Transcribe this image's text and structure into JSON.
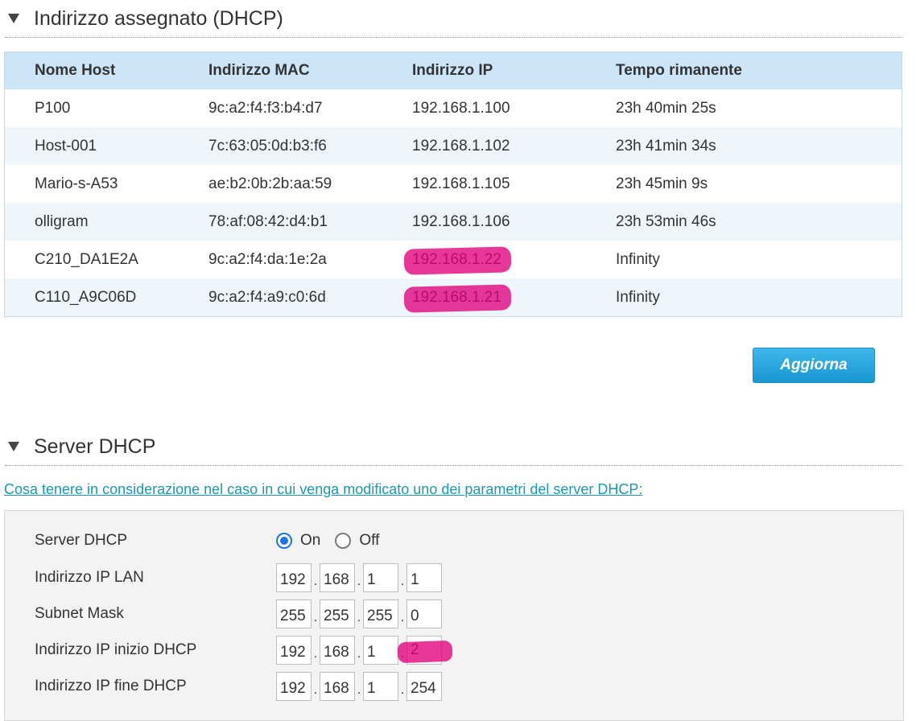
{
  "section_assigned": {
    "title": "Indirizzo assegnato (DHCP)"
  },
  "lease_table": {
    "headers": [
      "Nome Host",
      "Indirizzo MAC",
      "Indirizzo IP",
      "Tempo rimanente"
    ],
    "rows": [
      [
        "P100",
        "9c:a2:f4:f3:b4:d7",
        "192.168.1.100",
        "23h 40min 25s"
      ],
      [
        "Host-001",
        "7c:63:05:0d:b3:f6",
        "192.168.1.102",
        "23h 41min 34s"
      ],
      [
        "Mario-s-A53",
        "ae:b2:0b:2b:aa:59",
        "192.168.1.105",
        "23h 45min 9s"
      ],
      [
        "olligram",
        "78:af:08:42:d4:b1",
        "192.168.1.106",
        "23h 53min 46s"
      ],
      [
        "C210_DA1E2A",
        "9c:a2:f4:da:1e:2a",
        "192.168.1.22",
        "Infinity"
      ],
      [
        "C110_A9C06D",
        "9c:a2:f4:a9:c0:6d",
        "192.168.1.21",
        "Infinity"
      ]
    ]
  },
  "refresh_button": {
    "label": "Aggiorna"
  },
  "section_server": {
    "title": "Server DHCP"
  },
  "note_link": {
    "text": "Cosa tenere in considerazione nel caso in cui venga modificato uno dei parametri del server DHCP:"
  },
  "form": {
    "dhcp_server": {
      "label": "Server DHCP",
      "on_label": "On",
      "off_label": "Off",
      "selected": "On"
    },
    "lan_ip": {
      "label": "Indirizzo IP LAN",
      "octets": [
        "192",
        "168",
        "1",
        "1"
      ]
    },
    "subnet_mask": {
      "label": "Subnet Mask",
      "octets": [
        "255",
        "255",
        "255",
        "0"
      ]
    },
    "dhcp_start": {
      "label": "Indirizzo IP inizio DHCP",
      "octets": [
        "192",
        "168",
        "1",
        "2"
      ]
    },
    "dhcp_end": {
      "label": "Indirizzo IP fine DHCP",
      "octets": [
        "192",
        "168",
        "1",
        "254"
      ]
    }
  },
  "colors": {
    "accent": "#1897d2",
    "table_header": "#cce5f8",
    "link": "#1a98b5",
    "redaction": "#e0007c"
  }
}
